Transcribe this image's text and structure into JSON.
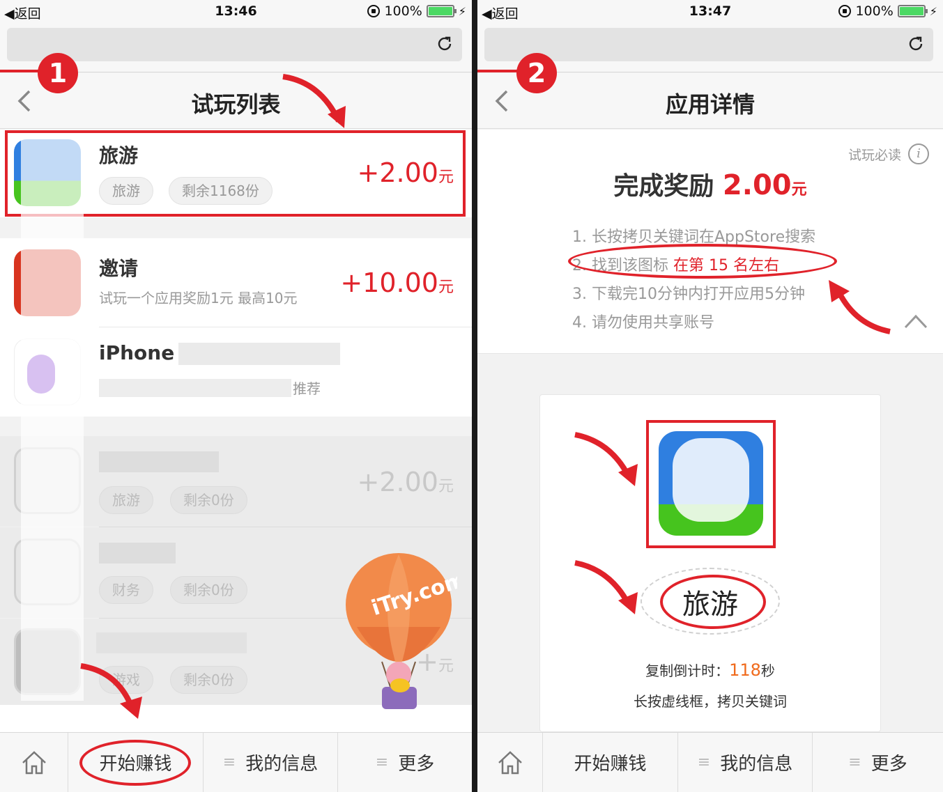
{
  "screen1": {
    "status": {
      "back": "◀返回",
      "time": "13:46",
      "battery": "100%"
    },
    "step": "1",
    "title": "试玩列表",
    "rows": [
      {
        "name": "旅游",
        "tags": [
          "旅游",
          "剩余1168份"
        ],
        "reward": "+2.00",
        "unit": "元"
      },
      {
        "name": "邀请",
        "sub": "试玩一个应用奖励1元 最高10元",
        "reward": "+10.00",
        "unit": "元"
      },
      {
        "name": "iPhone",
        "sub": "推荐"
      },
      {
        "name": "",
        "tags": [
          "旅游",
          "剩余0份"
        ],
        "reward": "+2.00",
        "unit": "元"
      },
      {
        "name": "",
        "tags": [
          "财务",
          "剩余0份"
        ]
      },
      {
        "name": "",
        "tags": [
          "游戏",
          "剩余0份"
        ],
        "reward": "+",
        "unit": "元"
      }
    ],
    "balloon_text": "iTry.com",
    "tabs": {
      "earn": "开始赚钱",
      "info": "我的信息",
      "more": "更多"
    }
  },
  "screen2": {
    "status": {
      "back": "◀返回",
      "time": "13:47",
      "battery": "100%"
    },
    "step": "2",
    "title": "应用详情",
    "must_read": "试玩必读",
    "bonus_label": "完成奖励",
    "bonus_amount": "2.00",
    "bonus_unit": "元",
    "steps": {
      "s1": "1. 长按拷贝关键词在AppStore搜索",
      "s2_a": "2. 找到该图标 ",
      "s2_b": "在第 15 名左右",
      "s3": "3. 下载完10分钟内打开应用5分钟",
      "s4": "4. 请勿使用共享账号"
    },
    "keyword": "旅游",
    "countdown_label": "复制倒计时：",
    "countdown_value": "118",
    "countdown_unit": "秒",
    "hint": "长按虚线框，拷贝关键词",
    "tabs": {
      "earn": "开始赚钱",
      "info": "我的信息",
      "more": "更多"
    }
  },
  "colors": {
    "accent_red": "#e0222a",
    "icon_blue": "#2f7fe0",
    "icon_green": "#46c41e"
  }
}
